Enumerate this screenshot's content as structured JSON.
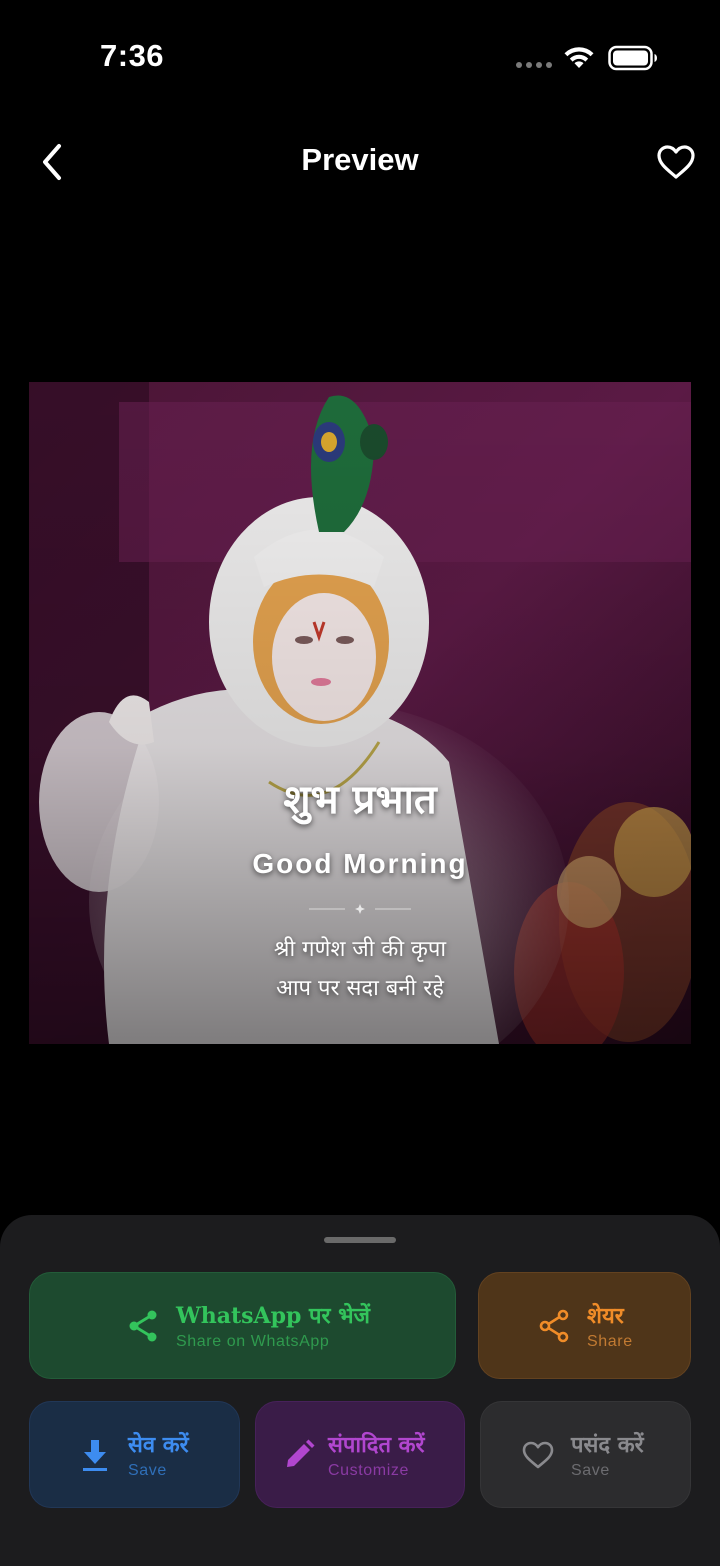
{
  "status_bar": {
    "time": "7:36"
  },
  "header": {
    "title": "Preview"
  },
  "preview": {
    "title_hindi": "शुभ प्रभात",
    "title_english": "Good Morning",
    "blessing_line1": "श्री गणेश जी की कृपा",
    "blessing_line2": "आप पर सदा बनी रहे"
  },
  "actions": {
    "whatsapp": {
      "label": "WhatsApp पर भेजें",
      "sublabel": "Share on WhatsApp",
      "icon": "share-icon"
    },
    "share": {
      "label": "शेयर",
      "sublabel": "Share",
      "icon": "share-icon"
    },
    "save": {
      "label": "सेव करें",
      "sublabel": "Save",
      "icon": "download-icon"
    },
    "customize": {
      "label": "संपादित करें",
      "sublabel": "Customize",
      "icon": "pencil-icon"
    },
    "like": {
      "label": "पसंद करें",
      "sublabel": "Save",
      "icon": "heart-icon"
    }
  },
  "colors": {
    "background": "#000000",
    "sheet": "#1c1c1e",
    "whatsapp_accent": "#33c45c",
    "share_accent": "#f08c28",
    "save_accent": "#3d8cf0",
    "customize_accent": "#b146cf",
    "like_accent": "#8a8a8e"
  }
}
